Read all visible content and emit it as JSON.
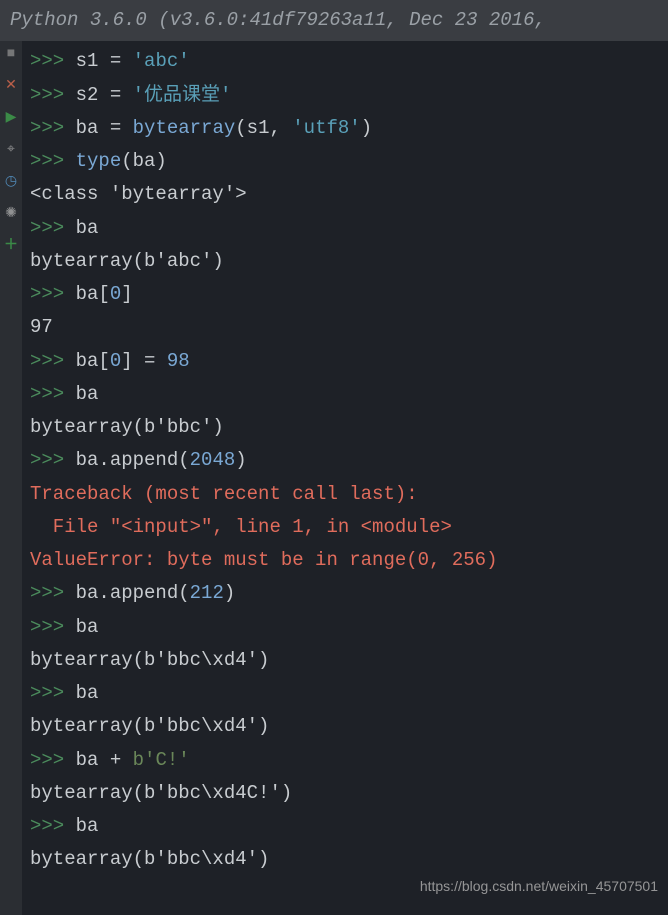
{
  "titlebar": "Python 3.6.0 (v3.6.0:41df79263a11, Dec 23 2016,",
  "gutter_icons": [
    "square",
    "x",
    "play",
    "tool",
    "clock",
    "bug",
    "plus"
  ],
  "lines": [
    {
      "type": "in",
      "tokens": [
        [
          "plain",
          "s1 "
        ],
        [
          "op",
          "= "
        ],
        [
          "str",
          "'abc'"
        ]
      ]
    },
    {
      "type": "in",
      "tokens": [
        [
          "plain",
          "s2 "
        ],
        [
          "op",
          "= "
        ],
        [
          "str",
          "'优品课堂'"
        ]
      ]
    },
    {
      "type": "in",
      "tokens": [
        [
          "plain",
          "ba "
        ],
        [
          "op",
          "= "
        ],
        [
          "func",
          "bytearray"
        ],
        [
          "plain",
          "(s1, "
        ],
        [
          "str",
          "'utf8'"
        ],
        [
          "plain",
          ")"
        ]
      ]
    },
    {
      "type": "in",
      "tokens": [
        [
          "func",
          "type"
        ],
        [
          "plain",
          "(ba)"
        ]
      ]
    },
    {
      "type": "out",
      "tokens": [
        [
          "out",
          "<class 'bytearray'>"
        ]
      ]
    },
    {
      "type": "in",
      "tokens": [
        [
          "plain",
          "ba"
        ]
      ]
    },
    {
      "type": "out",
      "tokens": [
        [
          "out",
          "bytearray(b'abc')"
        ]
      ]
    },
    {
      "type": "in",
      "tokens": [
        [
          "plain",
          "ba["
        ],
        [
          "num",
          "0"
        ],
        [
          "plain",
          "]"
        ]
      ]
    },
    {
      "type": "out",
      "tokens": [
        [
          "out",
          "97"
        ]
      ]
    },
    {
      "type": "in",
      "tokens": [
        [
          "plain",
          "ba["
        ],
        [
          "num",
          "0"
        ],
        [
          "plain",
          "] "
        ],
        [
          "op",
          "= "
        ],
        [
          "num",
          "98"
        ]
      ]
    },
    {
      "type": "in",
      "tokens": [
        [
          "plain",
          "ba"
        ]
      ]
    },
    {
      "type": "out",
      "tokens": [
        [
          "out",
          "bytearray(b'bbc')"
        ]
      ]
    },
    {
      "type": "in",
      "tokens": [
        [
          "plain",
          "ba.append("
        ],
        [
          "num",
          "2048"
        ],
        [
          "plain",
          ")"
        ]
      ]
    },
    {
      "type": "err",
      "tokens": [
        [
          "err",
          "Traceback (most recent call last):"
        ]
      ]
    },
    {
      "type": "err",
      "tokens": [
        [
          "err",
          "  File \"<input>\", line 1, in <module>"
        ]
      ]
    },
    {
      "type": "err",
      "tokens": [
        [
          "err",
          "ValueError: byte must be in range(0, 256)"
        ]
      ]
    },
    {
      "type": "in",
      "tokens": [
        [
          "plain",
          "ba.append("
        ],
        [
          "num",
          "212"
        ],
        [
          "plain",
          ")"
        ]
      ]
    },
    {
      "type": "in",
      "tokens": [
        [
          "plain",
          "ba"
        ]
      ]
    },
    {
      "type": "out",
      "tokens": [
        [
          "out",
          "bytearray(b'bbc\\xd4')"
        ]
      ]
    },
    {
      "type": "in",
      "tokens": [
        [
          "plain",
          "ba"
        ]
      ]
    },
    {
      "type": "out",
      "tokens": [
        [
          "out",
          "bytearray(b'bbc\\xd4')"
        ]
      ]
    },
    {
      "type": "in",
      "tokens": [
        [
          "plain",
          "ba "
        ],
        [
          "op",
          "+ "
        ],
        [
          "bstr",
          "b'C!'"
        ]
      ]
    },
    {
      "type": "out",
      "tokens": [
        [
          "out",
          "bytearray(b'bbc\\xd4C!')"
        ]
      ]
    },
    {
      "type": "in",
      "tokens": [
        [
          "plain",
          "ba"
        ]
      ]
    },
    {
      "type": "out",
      "tokens": [
        [
          "out",
          "bytearray(b'bbc\\xd4')"
        ]
      ]
    }
  ],
  "prompt": ">>> ",
  "watermark": "https://blog.csdn.net/weixin_45707501"
}
